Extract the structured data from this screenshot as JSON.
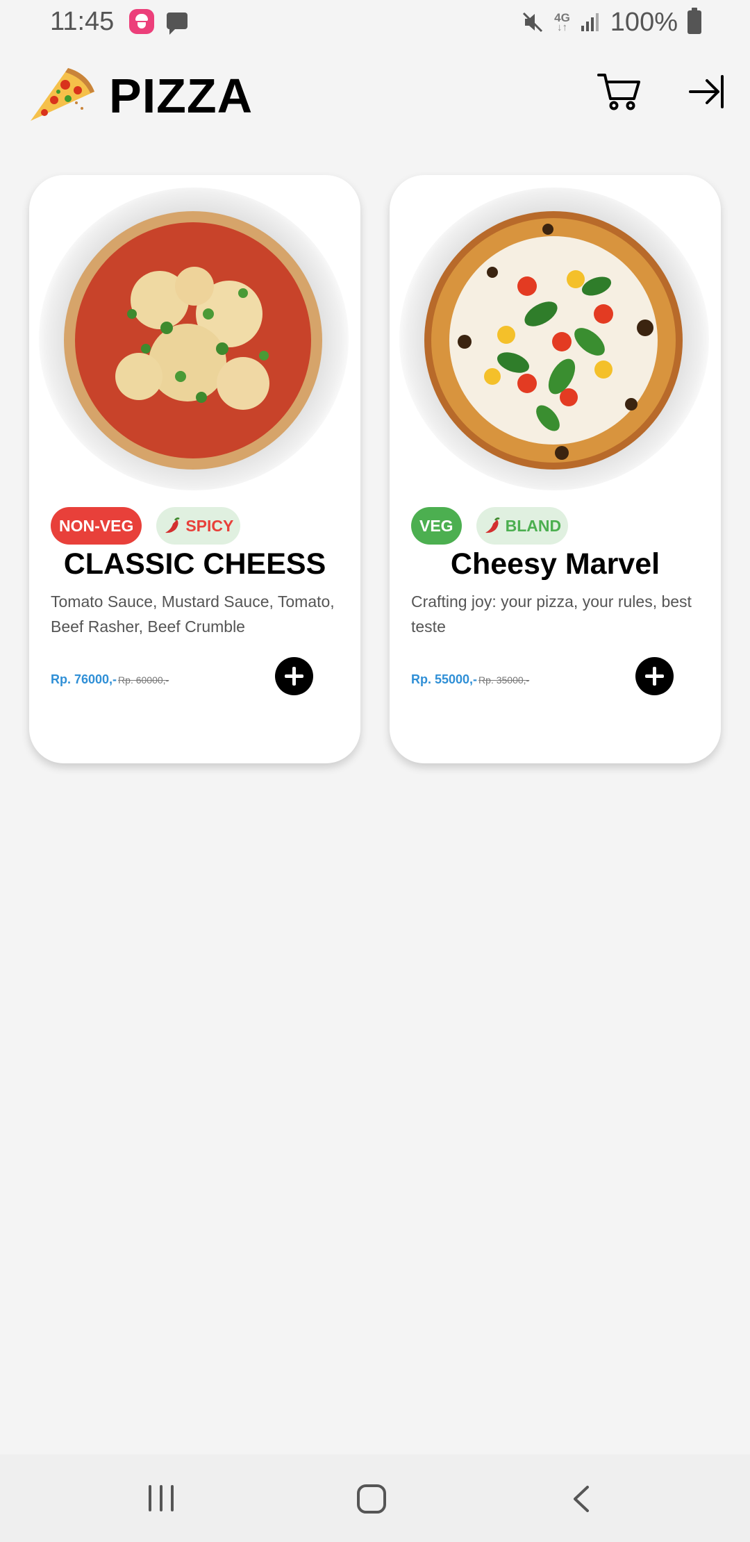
{
  "status_bar": {
    "time": "11:45",
    "network": "4G",
    "battery": "100%",
    "icons": [
      "app-notification-icon",
      "message-icon",
      "mute-icon",
      "signal-icon",
      "battery-icon"
    ]
  },
  "app_bar": {
    "title": "PIZZA",
    "logo_icon": "pizza-slice-icon",
    "cart_icon": "cart-icon",
    "logout_icon": "logout-icon"
  },
  "products": [
    {
      "diet_tag": "NON-VEG",
      "spice_tag": "SPICY",
      "name": "CLASSIC CHEESS",
      "description": "Tomato Sauce, Mustard Sauce, Tomato, Beef Rasher, Beef Crumble",
      "price": "Rp. 76000,-",
      "old_price": "Rp. 60000,-"
    },
    {
      "diet_tag": "VEG",
      "spice_tag": "BLAND",
      "name": "Cheesy Marvel",
      "description": "Crafting joy: your pizza, your rules, best teste",
      "price": "Rp. 55000,-",
      "old_price": "Rp. 35000,-"
    }
  ],
  "colors": {
    "background": "#f4f4f4",
    "non_veg": "#e8403a",
    "veg": "#4caf50",
    "tag_bg": "#e0f0e0",
    "price": "#2f8fd6"
  },
  "nav_bar": {
    "icons": [
      "recents-icon",
      "home-icon",
      "back-icon"
    ]
  }
}
